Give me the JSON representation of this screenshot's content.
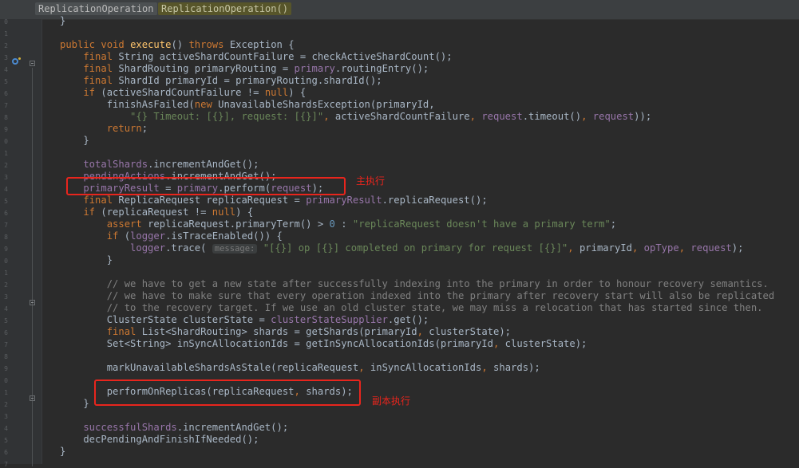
{
  "breadcrumbs": [
    "ReplicationOperation",
    "ReplicationOperation()"
  ],
  "annotations": {
    "primary": "主执行",
    "replica": "副本执行"
  },
  "lines": [
    [
      [
        "p",
        "}"
      ]
    ],
    [],
    [
      [
        "k",
        "public void "
      ],
      [
        "m",
        "execute"
      ],
      [
        "p",
        "() "
      ],
      [
        "k",
        "throws "
      ],
      [
        "p",
        "Exception {"
      ]
    ],
    [
      [
        "k",
        "    final "
      ],
      [
        "p",
        "String activeShardCountFailure = checkActiveShardCount();"
      ]
    ],
    [
      [
        "k",
        "    final "
      ],
      [
        "p",
        "ShardRouting primaryRouting = "
      ],
      [
        "f",
        "primary"
      ],
      [
        "p",
        ".routingEntry();"
      ]
    ],
    [
      [
        "k",
        "    final "
      ],
      [
        "p",
        "ShardId primaryId = primaryRouting.shardId();"
      ]
    ],
    [
      [
        "k",
        "    if "
      ],
      [
        "p",
        "(activeShardCountFailure != "
      ],
      [
        "k",
        "null"
      ],
      [
        "p",
        ") {"
      ]
    ],
    [
      [
        "p",
        "        finishAsFailed("
      ],
      [
        "k",
        "new "
      ],
      [
        "p",
        "UnavailableShardsException(primaryId,"
      ]
    ],
    [
      [
        "s",
        "            \"{} Timeout: [{}], request: [{}]\""
      ],
      [
        "k",
        ", "
      ],
      [
        "p",
        "activeShardCountFailure"
      ],
      [
        "k",
        ", "
      ],
      [
        "f",
        "request"
      ],
      [
        "p",
        ".timeout()"
      ],
      [
        "k",
        ", "
      ],
      [
        "f",
        "request"
      ],
      [
        "p",
        "));"
      ]
    ],
    [
      [
        "k",
        "        return"
      ],
      [
        "p",
        ";"
      ]
    ],
    [
      [
        "p",
        "    }"
      ]
    ],
    [],
    [
      [
        "f",
        "    totalShards"
      ],
      [
        "p",
        ".incrementAndGet();"
      ]
    ],
    [
      [
        "f",
        "    pendingActions"
      ],
      [
        "p",
        ".incrementAndGet();"
      ]
    ],
    [
      [
        "f",
        "    primaryResult "
      ],
      [
        "p",
        "= "
      ],
      [
        "f",
        "primary"
      ],
      [
        "p",
        ".perform("
      ],
      [
        "f",
        "request"
      ],
      [
        "p",
        ");"
      ]
    ],
    [
      [
        "k",
        "    final "
      ],
      [
        "p",
        "ReplicaRequest replicaRequest = "
      ],
      [
        "f",
        "primaryResult"
      ],
      [
        "p",
        ".replicaRequest();"
      ]
    ],
    [
      [
        "k",
        "    if "
      ],
      [
        "p",
        "(replicaRequest != "
      ],
      [
        "k",
        "null"
      ],
      [
        "p",
        ") {"
      ]
    ],
    [
      [
        "k",
        "        assert "
      ],
      [
        "p",
        "replicaRequest.primaryTerm() > "
      ],
      [
        "n",
        "0 "
      ],
      [
        "p",
        ": "
      ],
      [
        "s",
        "\"replicaRequest doesn't have a primary term\""
      ],
      [
        "p",
        ";"
      ]
    ],
    [
      [
        "k",
        "        if "
      ],
      [
        "p",
        "("
      ],
      [
        "f",
        "logger"
      ],
      [
        "p",
        ".isTraceEnabled()) {"
      ]
    ],
    [
      [
        "f",
        "            logger"
      ],
      [
        "p",
        ".trace( "
      ],
      [
        "h",
        "message:"
      ],
      [
        "s",
        " \"[{}] op [{}] completed on primary for request [{}]\""
      ],
      [
        "k",
        ", "
      ],
      [
        "p",
        "primaryId"
      ],
      [
        "k",
        ", "
      ],
      [
        "f",
        "opType"
      ],
      [
        "k",
        ", "
      ],
      [
        "f",
        "request"
      ],
      [
        "p",
        ");"
      ]
    ],
    [
      [
        "p",
        "        }"
      ]
    ],
    [],
    [
      [
        "c",
        "        // we have to get a new state after successfully indexing into the primary in order to honour recovery semantics."
      ]
    ],
    [
      [
        "c",
        "        // we have to make sure that every operation indexed into the primary after recovery start will also be replicated"
      ]
    ],
    [
      [
        "c",
        "        // to the recovery target. If we use an old cluster state, we may miss a relocation that has started since then."
      ]
    ],
    [
      [
        "p",
        "        ClusterState clusterState = "
      ],
      [
        "f",
        "clusterStateSupplier"
      ],
      [
        "p",
        ".get();"
      ]
    ],
    [
      [
        "k",
        "        final "
      ],
      [
        "p",
        "List<ShardRouting> shards = getShards(primaryId"
      ],
      [
        "k",
        ", "
      ],
      [
        "p",
        "clusterState);"
      ]
    ],
    [
      [
        "p",
        "        Set<String> inSyncAllocationIds = getInSyncAllocationIds(primaryId"
      ],
      [
        "k",
        ", "
      ],
      [
        "p",
        "clusterState);"
      ]
    ],
    [],
    [
      [
        "p",
        "        markUnavailableShardsAsStale(replicaRequest"
      ],
      [
        "k",
        ", "
      ],
      [
        "p",
        "inSyncAllocationIds"
      ],
      [
        "k",
        ", "
      ],
      [
        "p",
        "shards);"
      ]
    ],
    [],
    [
      [
        "p",
        "        performOnReplicas(replicaRequest"
      ],
      [
        "k",
        ", "
      ],
      [
        "p",
        "shards);"
      ]
    ],
    [
      [
        "p",
        "    }"
      ]
    ],
    [],
    [
      [
        "f",
        "    successfulShards"
      ],
      [
        "p",
        ".incrementAndGet();"
      ]
    ],
    [
      [
        "p",
        "    decPendingAndFinishIfNeeded();"
      ]
    ],
    [
      [
        "p",
        "}"
      ]
    ]
  ],
  "line_numbers": [
    "0",
    "1",
    "2",
    "3",
    "4",
    "5",
    "6",
    "7",
    "8",
    "9",
    "0",
    "1",
    "2",
    "3",
    "4",
    "5",
    "6",
    "7",
    "8",
    "9",
    "0",
    "1",
    "2",
    "3",
    "4",
    "5",
    "6",
    "7",
    "8",
    "9",
    "0",
    "1",
    "2",
    "3",
    "4",
    "5",
    "6",
    "7"
  ]
}
